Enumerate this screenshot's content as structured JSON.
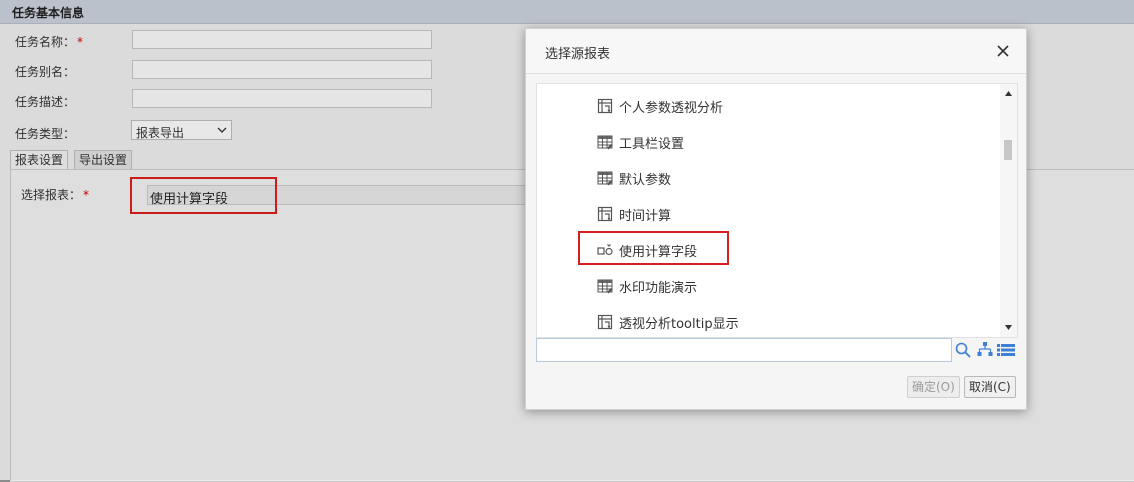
{
  "page": {
    "header_title": "任务基本信息",
    "fields": [
      {
        "label": "任务名称：",
        "required": "*"
      },
      {
        "label": "任务别名："
      },
      {
        "label": "任务描述："
      }
    ],
    "task_type_label": "任务类型：",
    "task_type_value": "报表导出",
    "tabs": [
      "报表设置",
      "导出设置"
    ],
    "select_report_label": "选择报表：",
    "select_report_required": "*",
    "select_report_value": "使用计算字段"
  },
  "dialog": {
    "title": "选择源报表",
    "close_icon": "close-icon",
    "tree_items": [
      {
        "label": "个人参数透视分析",
        "icon": "pivot-report-icon"
      },
      {
        "label": "工具栏设置",
        "icon": "grid-report-icon"
      },
      {
        "label": "默认参数",
        "icon": "grid-report-icon"
      },
      {
        "label": "时间计算",
        "icon": "pivot-report-icon"
      },
      {
        "label": "使用计算字段",
        "icon": "calc-field-icon"
      },
      {
        "label": "水印功能演示",
        "icon": "grid-report-icon"
      },
      {
        "label": "透视分析tooltip显示",
        "icon": "pivot-report-icon"
      }
    ],
    "search_placeholder": "",
    "ok_label": "确定(O)",
    "cancel_label": "取消(C)"
  },
  "colors": {
    "highlight": "#d81e1e",
    "header_bg": "#c7ced8",
    "accent_blue": "#3d7fd4"
  }
}
